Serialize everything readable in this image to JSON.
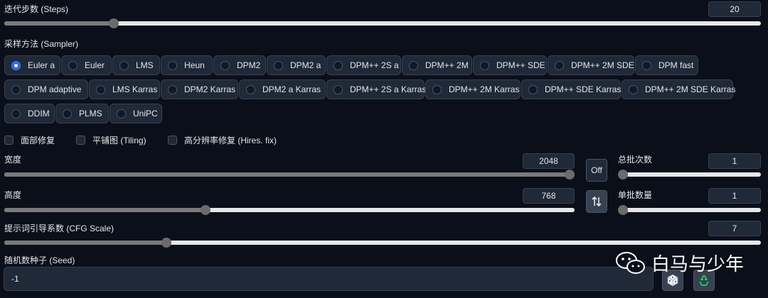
{
  "steps": {
    "label": "迭代步数 (Steps)",
    "value": "20",
    "fraction": 0.14
  },
  "sampler": {
    "label": "采样方法 (Sampler)",
    "selected": "Euler a",
    "rows": [
      [
        "Euler a",
        "Euler",
        "LMS",
        "Heun",
        "DPM2",
        "DPM2 a",
        "DPM++ 2S a",
        "DPM++ 2M",
        "DPM++ SDE",
        "DPM++ 2M SDE",
        "DPM fast"
      ],
      [
        "DPM adaptive",
        "LMS Karras",
        "DPM2 Karras",
        "DPM2 a Karras",
        "DPM++ 2S a Karras",
        "DPM++ 2M Karras",
        "DPM++ SDE Karras",
        "DPM++ 2M SDE Karras"
      ],
      [
        "DDIM",
        "PLMS",
        "UniPC"
      ]
    ]
  },
  "options": {
    "face_restore": "面部修复",
    "tiling": "平铺图 (Tiling)",
    "hires_fix": "高分辨率修复 (Hires. fix)"
  },
  "width": {
    "label": "宽度",
    "value": "2048",
    "fraction": 1.0
  },
  "height": {
    "label": "高度",
    "value": "768",
    "fraction": 0.35
  },
  "off_button": "Off",
  "swap_icon": "swap-vertical-icon",
  "batch_count": {
    "label": "总批次数",
    "value": "1",
    "fraction": 0.0
  },
  "batch_size": {
    "label": "单批数量",
    "value": "1",
    "fraction": 0.0
  },
  "cfg": {
    "label": "提示词引导系数 (CFG Scale)",
    "value": "7",
    "fraction": 0.21
  },
  "seed": {
    "label": "随机数种子 (Seed)",
    "value": "-1"
  },
  "icons": {
    "dice": "dice-icon",
    "recycle": "recycle-icon"
  },
  "watermark": {
    "text": "白马与少年"
  }
}
